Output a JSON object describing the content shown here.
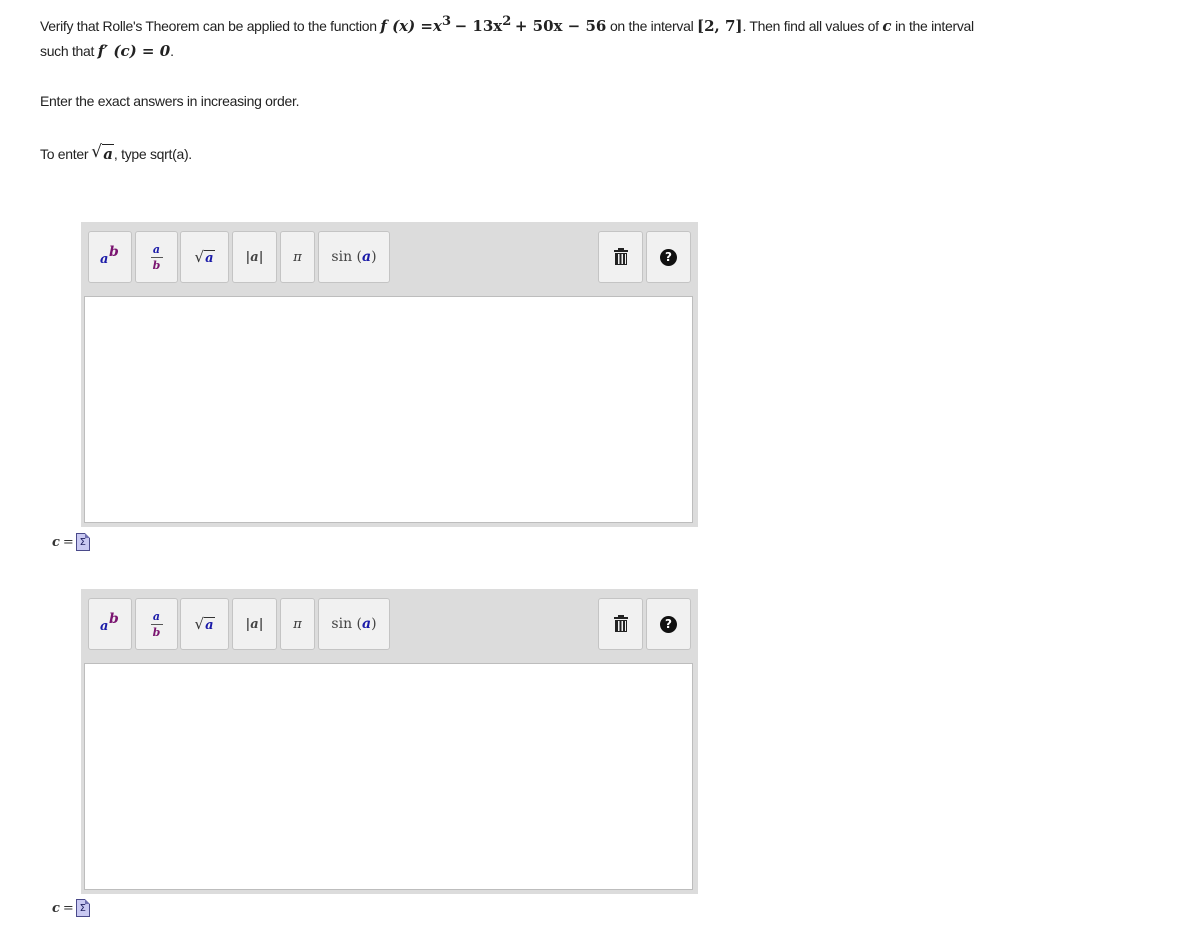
{
  "question": {
    "line1_a": "Verify that Rolle's Theorem can be applied to the function",
    "fx_lhs": "f (x) =",
    "fx_x": "x",
    "fx_exp3": "3",
    "fx_minus13": "− 13x",
    "fx_exp2": "2",
    "fx_tail": "+ 50x − 56",
    "line1_b": "on the interval",
    "interval": "[2, 7]",
    "line1_c": ". Then find all values of",
    "c_var": "c",
    "line1_d": "in the interval",
    "line2_a": "such that",
    "fprime": "f′ (c) = 0",
    "line2_end": "."
  },
  "instructions": {
    "enter_exact": "Enter the exact answers in increasing order.",
    "to_enter_prefix": "To enter",
    "sqrt_arg": "a",
    "to_enter_suffix": ", type sqrt(a)."
  },
  "toolbar": {
    "pow_base": "a",
    "pow_exp": "b",
    "frac_num": "a",
    "frac_den": "b",
    "sqrt_arg": "a",
    "abs_label": "|a|",
    "pi_label": "π",
    "sin_fn": "sin (",
    "sin_arg": "a",
    "sin_close": ")",
    "help_glyph": "?"
  },
  "answers": [
    {
      "label_var": "c",
      "label_eq": "=",
      "value": ""
    },
    {
      "label_var": "c",
      "label_eq": "=",
      "value": ""
    }
  ],
  "sigma_icon_glyph": "Σ",
  "colors": {
    "toolbar_bg": "#dcdcdc",
    "var_a": "#1a1aa8",
    "var_b": "#7a1470"
  }
}
